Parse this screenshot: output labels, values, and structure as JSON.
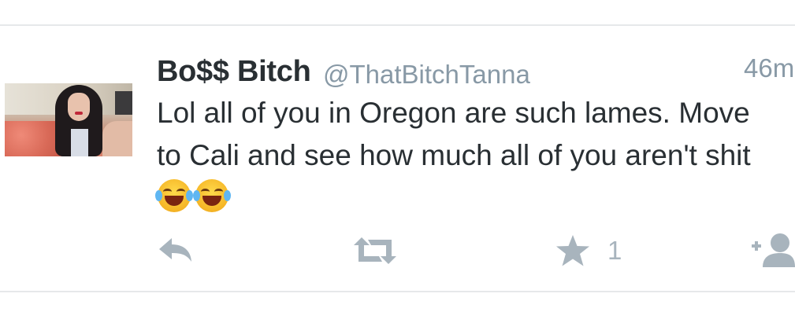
{
  "tweet": {
    "display_name": "Bo$$ Bitch",
    "handle": "@ThatBitchTanna",
    "time": "46m",
    "text_lines": [
      "Lol all of you in Oregon are such lames. Move",
      "to Cali and see how much all of you aren't shit"
    ],
    "emojis": [
      "face-with-tears-of-joy-icon",
      "face-with-tears-of-joy-icon"
    ],
    "favorite_count": "1"
  },
  "actions": {
    "reply_icon": "reply-icon",
    "retweet_icon": "retweet-icon",
    "favorite_icon": "star-icon",
    "follow_icon": "add-user-icon"
  },
  "colors": {
    "name": "#292f33",
    "secondary": "#8899a6",
    "action": "#a8b4bd",
    "divider": "#e6e8ea"
  }
}
